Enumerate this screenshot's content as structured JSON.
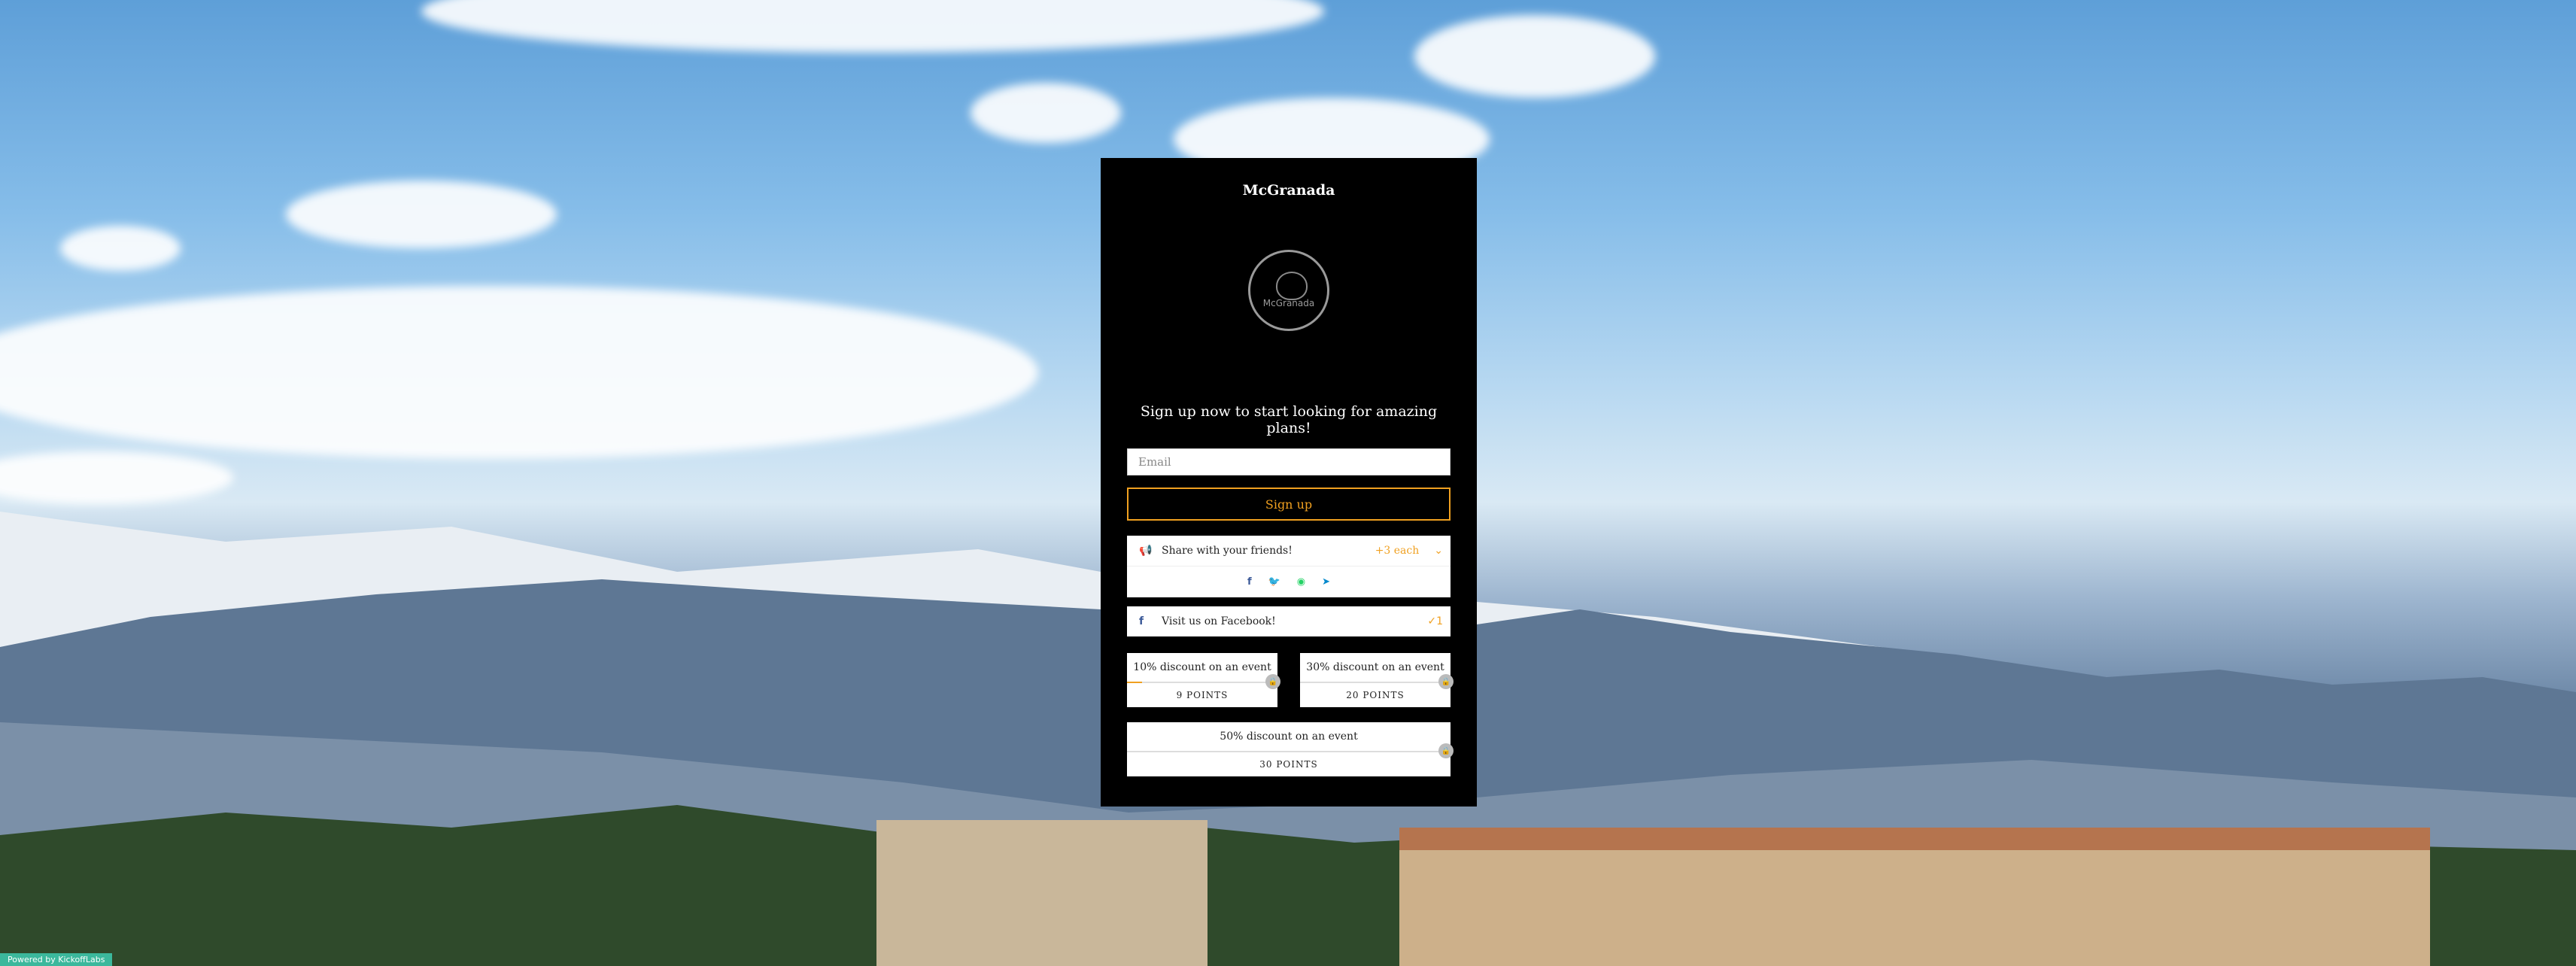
{
  "brand": {
    "name": "McGranada",
    "logo_text": "McGranada"
  },
  "form": {
    "headline": "Sign up now to start looking for amazing plans!",
    "email_placeholder": "Email",
    "signup_label": "Sign up"
  },
  "share": {
    "label": "Share with your friends!",
    "points": "+3 each",
    "icons": [
      "facebook-icon",
      "twitter-icon",
      "whatsapp-icon",
      "telegram-icon"
    ]
  },
  "facebook_task": {
    "label": "Visit us on Facebook!",
    "points": "1"
  },
  "rewards": [
    {
      "title": "10% discount on an event",
      "points": "9 POINTS",
      "progress": 0.1
    },
    {
      "title": "30% discount on an event",
      "points": "20 POINTS",
      "progress": 0
    },
    {
      "title": "50% discount on an event",
      "points": "30 POINTS",
      "progress": 0
    }
  ],
  "footer": {
    "powered_by": "Powered by KickoffLabs"
  },
  "colors": {
    "accent": "#f0a020",
    "card_bg": "#000000",
    "badge": "#3bb89c"
  }
}
